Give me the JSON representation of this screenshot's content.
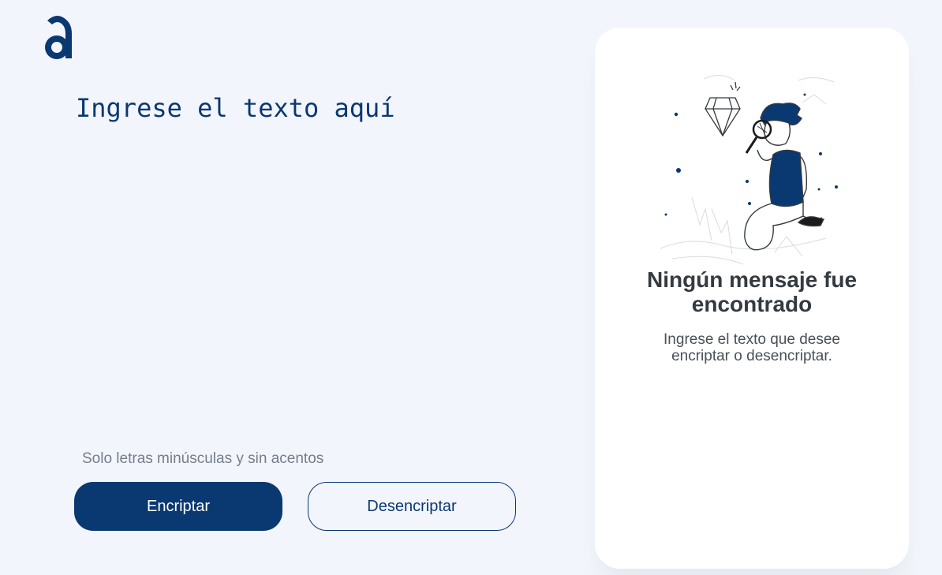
{
  "brand": {
    "logo_letter": "a",
    "color": "#0a3871"
  },
  "input": {
    "placeholder": "Ingrese el texto aquí",
    "value": ""
  },
  "hint": {
    "text": "Solo letras minúsculas y sin acentos",
    "icon": "info-icon"
  },
  "buttons": {
    "encrypt_label": "Encriptar",
    "decrypt_label": "Desencriptar"
  },
  "output": {
    "title": "Ningún mensaje fue encontrado",
    "description": "Ingrese el texto que desee encriptar o desencriptar.",
    "illustration": "person-with-magnifying-glass"
  },
  "colors": {
    "background": "#f3f5fc",
    "primary": "#0a3871",
    "card": "#ffffff"
  }
}
